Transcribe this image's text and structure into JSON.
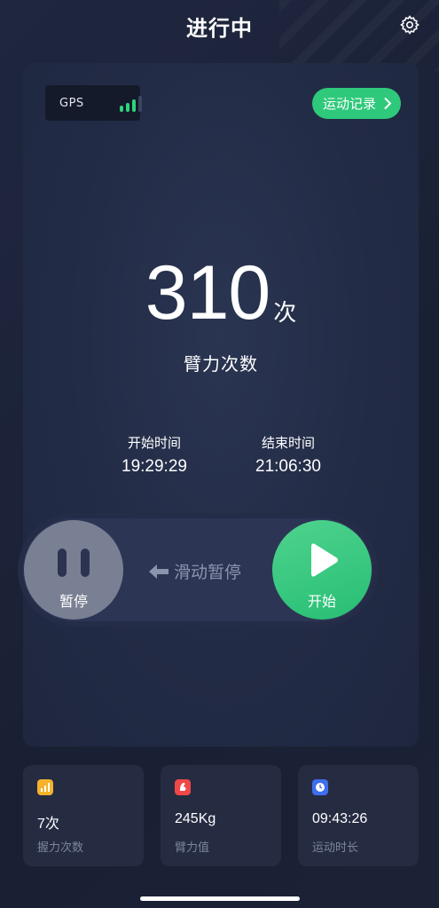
{
  "header": {
    "title": "进行中",
    "settings_icon": "gear-icon"
  },
  "card": {
    "gps_label": "GPS",
    "gps_signal_level": 4,
    "records_label": "运动记录",
    "count_value": "310",
    "count_unit": "次",
    "count_label": "臂力次数",
    "start_time_label": "开始时间",
    "start_time_value": "19:29:29",
    "end_time_label": "结束时间",
    "end_time_value": "21:06:30"
  },
  "controls": {
    "pause_label": "暂停",
    "slide_hint": "滑动暂停",
    "start_label": "开始"
  },
  "stats": [
    {
      "value": "7次",
      "label": "握力次数",
      "icon": "bar-chart-icon",
      "color": "#f5b22a"
    },
    {
      "value": "245Kg",
      "label": "臂力值",
      "icon": "arm-icon",
      "color": "#f04848"
    },
    {
      "value": "09:43:26",
      "label": "运动时长",
      "icon": "clock-icon",
      "color": "#3d6ef0"
    }
  ],
  "colors": {
    "accent": "#2ec97a",
    "background": "#1c2336",
    "card": "#252c42"
  }
}
